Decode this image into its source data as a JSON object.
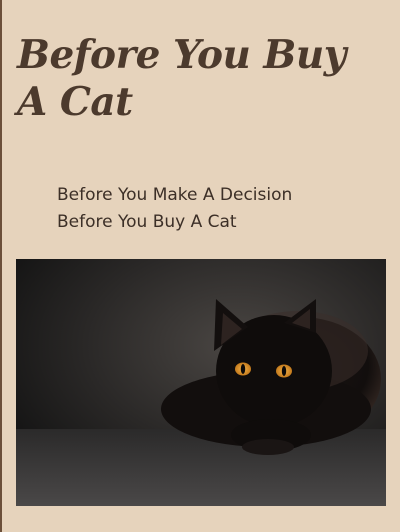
{
  "page": {
    "title": "Before You Buy A Cat"
  },
  "links": [
    {
      "label": "Before You Make A Decision"
    },
    {
      "label": "Before You Buy A Cat"
    }
  ],
  "hero_image": {
    "alt": "black cat"
  },
  "colors": {
    "background": "#e6d3bc",
    "title": "#4c3a2d",
    "text": "#3c2f27"
  }
}
